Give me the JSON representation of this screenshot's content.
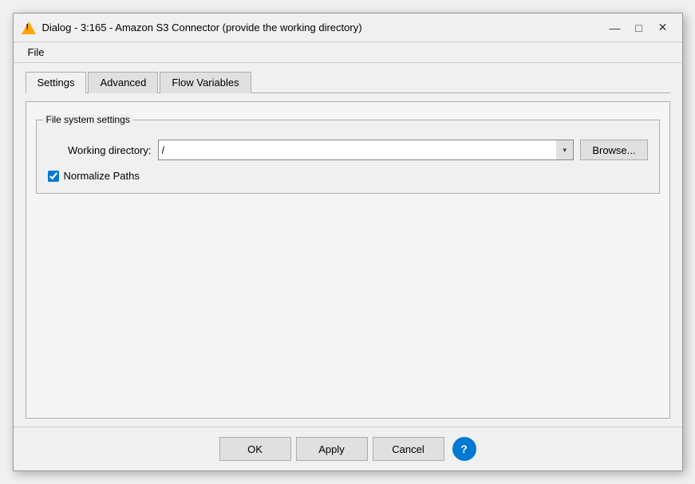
{
  "window": {
    "title": "Dialog - 3:165 - Amazon S3 Connector (provide the working directory)",
    "icon": "warning-icon"
  },
  "title_controls": {
    "minimize": "—",
    "maximize": "□",
    "close": "✕"
  },
  "menu": {
    "file_label": "File"
  },
  "tabs": [
    {
      "id": "settings",
      "label": "Settings",
      "active": true
    },
    {
      "id": "advanced",
      "label": "Advanced",
      "active": false
    },
    {
      "id": "flow-variables",
      "label": "Flow Variables",
      "active": false
    }
  ],
  "settings_panel": {
    "group_title": "File system settings",
    "working_directory_label": "Working directory:",
    "working_directory_value": "/",
    "working_directory_placeholder": "/",
    "browse_label": "Browse...",
    "normalize_paths_label": "Normalize Paths",
    "normalize_paths_checked": true
  },
  "footer": {
    "ok_label": "OK",
    "apply_label": "Apply",
    "cancel_label": "Cancel",
    "help_label": "?"
  }
}
